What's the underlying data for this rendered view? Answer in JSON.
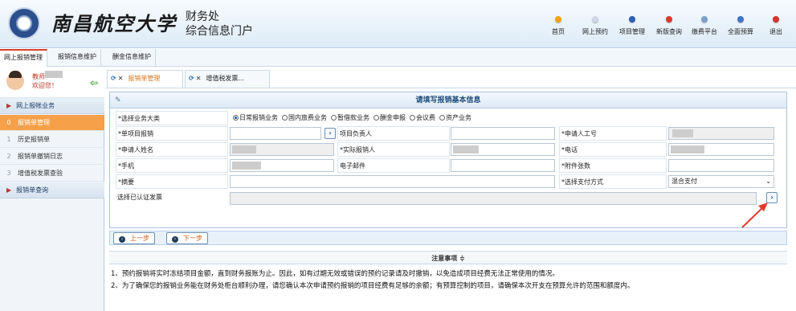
{
  "header": {
    "university": "南昌航空大学",
    "dept_line1": "财务处",
    "dept_line2": "综合信息门户",
    "nav": [
      {
        "label": "首页",
        "color": "#f2a20c"
      },
      {
        "label": "网上预约",
        "color": "#cfd8e6"
      },
      {
        "label": "项目管理",
        "color": "#2d5fb5"
      },
      {
        "label": "新版查询",
        "color": "#d93a2b"
      },
      {
        "label": "缴费平台",
        "color": "#7d9fca"
      },
      {
        "label": "全面预算",
        "color": "#3d74c4"
      },
      {
        "label": "退出",
        "color": "#d9342a"
      }
    ]
  },
  "main_tabs": [
    "网上报销管理",
    "报销信息维护",
    "酬金信息维护"
  ],
  "sidebar": {
    "user_name": "教师",
    "welcome": "欢迎您！",
    "group1": "网上报帐业务",
    "items": [
      {
        "num": "0",
        "label": "报销单管理"
      },
      {
        "num": "1",
        "label": "历史报销单"
      },
      {
        "num": "2",
        "label": "报销单撤销日志"
      },
      {
        "num": "3",
        "label": "增值税发票查验"
      }
    ],
    "group2": "报销单查询"
  },
  "page_tabs": [
    "报销单管理",
    "增值税发票..."
  ],
  "form": {
    "title": "请填写报销基本信息",
    "business_type_label": "*选择业务大类",
    "business_types": [
      "日常报销业务",
      "国内旅费业务",
      "暂借款业务",
      "酬金申报",
      "会议费",
      "资产业务"
    ],
    "project_label": "*单项目报销",
    "project_owner_label": "项目负责人",
    "applicant_id_label": "*申请人工号",
    "applicant_name_label": "*申请人姓名",
    "actual_person_label": "*实际报销人",
    "phone_label": "*电话",
    "mobile_label": "*手机",
    "email_label": "电子邮件",
    "attachments_label": "*附件张数",
    "summary_label": "*摘要",
    "payment_label": "*选择支付方式",
    "payment_value": "混合支付",
    "invoice_label": "选择已认证发票"
  },
  "buttons": {
    "prev": "上一步",
    "next": "下一步"
  },
  "notes": {
    "title": "注意事项 ≑",
    "line1": "1、预约报销将实时冻结项目金额，直到财务报账为止。因此，如有过期无效或错误的预约记录请及时撤销，以免造成项目经费无法正常使用的情况。",
    "line2": "2、为了确保您的报销业务能在财务处柜台顺利办理，请您确认本次申请预约报销的项目经费有足够的余额；有预算控制的项目，请确保本次开支在预算允许的范围和额度内。"
  },
  "annotation_color": "#e23b2e"
}
